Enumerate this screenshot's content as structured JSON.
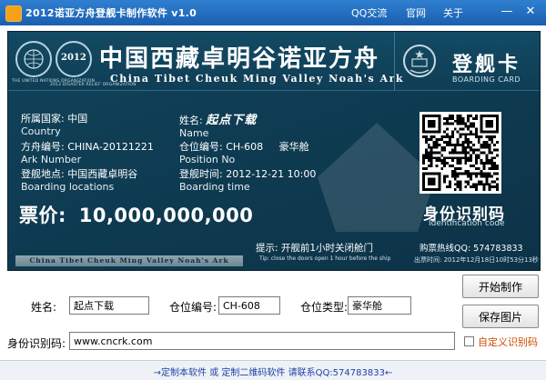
{
  "window": {
    "title": "2012诺亚方舟登舰卡制作软件 v1.0",
    "menu": [
      "QQ交流",
      "官网",
      "关于"
    ],
    "minimize_glyph": "—",
    "close_glyph": "✕"
  },
  "ticket": {
    "header_cn": "中国西藏卓明谷诺亚方舟",
    "header_en": "China Tibet Cheuk Ming Valley Noah's Ark",
    "boarding_cn": "登舰卡",
    "boarding_en": "BOARDING CARD",
    "emblem_un_text": "THE UNITED NATIONS ORGANIZATION",
    "emblem_2012_text": "2012 DISASTER RELIEF ORGANIZATION",
    "emblem_2012_label": "2012",
    "country_label_cn": "所属国家:",
    "country_value": "中国",
    "country_label_en": "Country",
    "ark_label_cn": "方舟编号:",
    "ark_value": "CHINA-20121221",
    "ark_label_en": "Ark Number",
    "location_label_cn": "登舰地点:",
    "location_value": "中国西藏卓明谷",
    "location_label_en": "Boarding locations",
    "name_label_cn": "姓名:",
    "name_value": "起点下载",
    "name_label_en": "Name",
    "position_label_cn": "仓位编号:",
    "position_value": "CH-608",
    "position_class": "豪华舱",
    "position_label_en": "Position No",
    "time_label_cn": "登舰时间:",
    "time_value": "2012-12-21 10:00",
    "time_label_en": "Boarding time",
    "price_label": "票价:",
    "price_value": "10,000,000,000",
    "idcode_cn": "身份识别码",
    "idcode_en": "Identification code",
    "strip_text": "China Tibet Cheuk Ming Valley Noah's Ark",
    "tip_cn": "提示: 开舰前1小时关闭舱门",
    "tip_en": "Tip: close the doors open 1 hour before the ship",
    "hotline": "购票热线QQ: 574783833",
    "issue_time": "出票时间: 2012年12月18日10时53分13秒"
  },
  "form": {
    "name_label": "姓名:",
    "name_value": "起点下载",
    "position_label": "仓位编号:",
    "position_value": "CH-608",
    "class_label": "仓位类型:",
    "class_value": "豪华舱",
    "id_label": "身份识别码:",
    "id_value": "www.cncrk.com",
    "start_button": "开始制作",
    "save_button": "保存图片",
    "custom_id_label": "自定义识别码"
  },
  "status": {
    "text": "→定制本软件 或 定制二维码软件 请联系QQ:574783833←"
  },
  "colors": {
    "titlebar": "#1a5fb0",
    "ticket_bg": "#0e3a50",
    "accent_orange": "#d04a00",
    "status_text": "#1f3fa8"
  }
}
